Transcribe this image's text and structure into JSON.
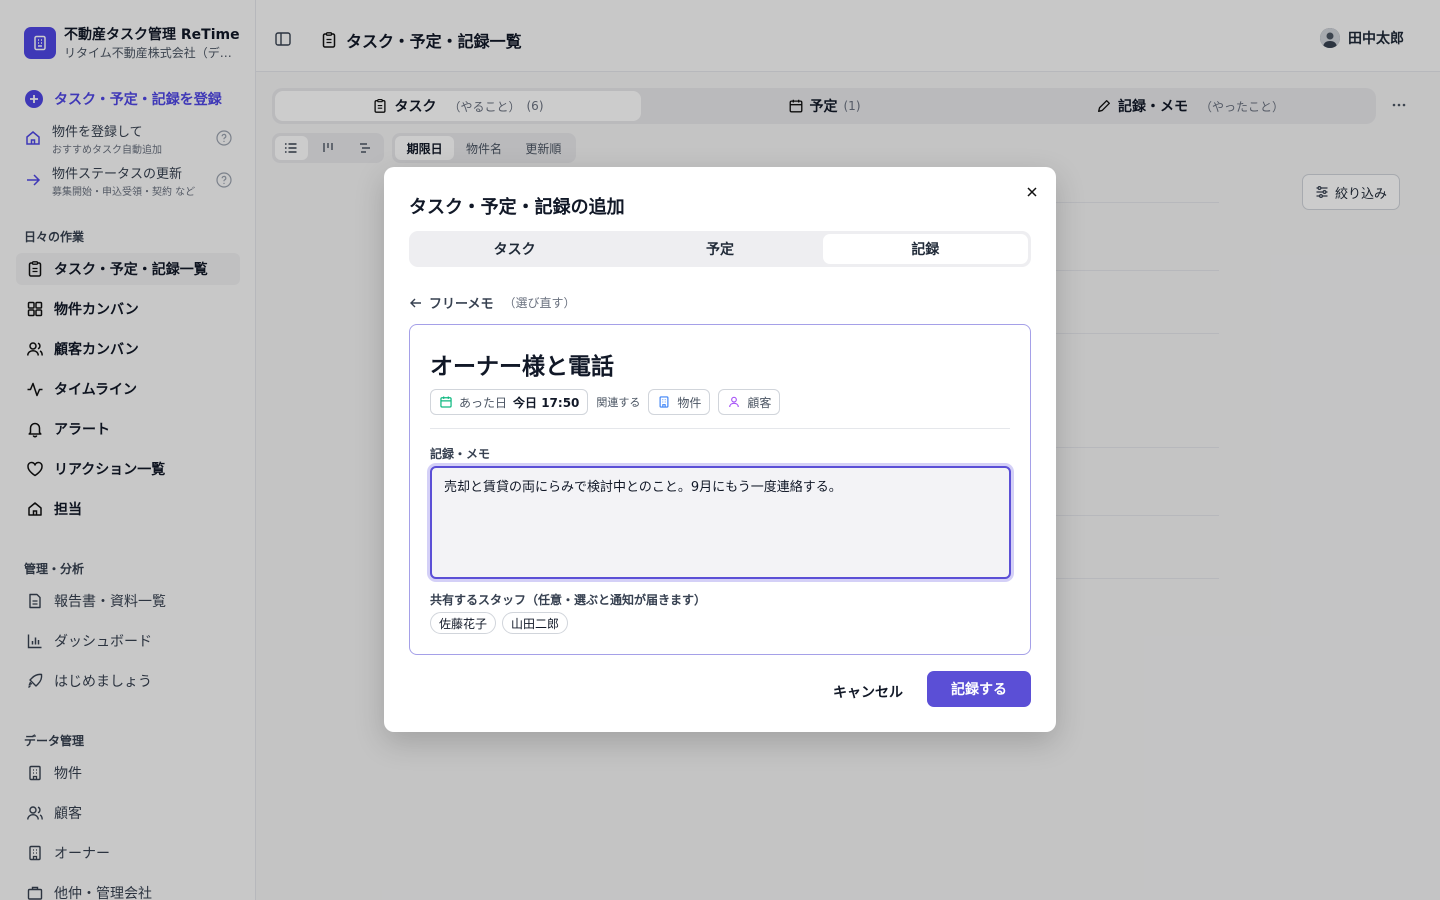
{
  "brand": {
    "title": "不動産タスク管理 ReTime",
    "subtitle": "リタイム不動産株式会社（デモ）"
  },
  "sidebar_actions": {
    "primary": "タスク・予定・記録を登録",
    "register_property": {
      "title": "物件を登録して",
      "sub": "おすすめタスク自動追加"
    },
    "update_status": {
      "title": "物件ステータスの更新",
      "sub": "募集開始・申込受領・契約 など"
    }
  },
  "sections": {
    "daily": "日々の作業",
    "admin": "管理・分析",
    "data": "データ管理"
  },
  "nav_daily": [
    "タスク・予定・記録一覧",
    "物件カンバン",
    "顧客カンバン",
    "タイムライン",
    "アラート",
    "リアクション一覧",
    "担当"
  ],
  "nav_admin": [
    "報告書・資料一覧",
    "ダッシュボード",
    "はじめましょう"
  ],
  "nav_data": [
    "物件",
    "顧客",
    "オーナー",
    "他仲・管理会社"
  ],
  "topbar": {
    "title": "タスク・予定・記録一覧",
    "user": "田中太郎"
  },
  "main_tabs": [
    {
      "label": "タスク",
      "sub": "（やること）",
      "count": "(6)"
    },
    {
      "label": "予定",
      "sub": "",
      "count": "(1)"
    },
    {
      "label": "記録・メモ",
      "sub": "（やったこと）",
      "count": ""
    }
  ],
  "sort": [
    "期限日",
    "物件名",
    "更新順"
  ],
  "filter_label": "絞り込み",
  "modal": {
    "title": "タスク・予定・記録の追加",
    "tabs": [
      "タスク",
      "予定",
      "記録"
    ],
    "back_label": "フリーメモ",
    "back_hint": "（選び直す）",
    "record_title": "オーナー様と電話",
    "date_label": "あった日",
    "date_value": "今日 17:50",
    "related_label": "関連する",
    "property_chip": "物件",
    "customer_chip": "顧客",
    "memo_label": "記録・メモ",
    "memo_value": "売却と賃貸の両にらみで検討中とのこと。9月にもう一度連絡する。",
    "staff_label": "共有するスタッフ（任意・選ぶと通知が届きます）",
    "staff": [
      "佐藤花子",
      "山田二郎"
    ],
    "cancel": "キャンセル",
    "submit": "記録する"
  },
  "colors": {
    "accent": "#5b4fd6",
    "brand": "#4f46e5"
  }
}
